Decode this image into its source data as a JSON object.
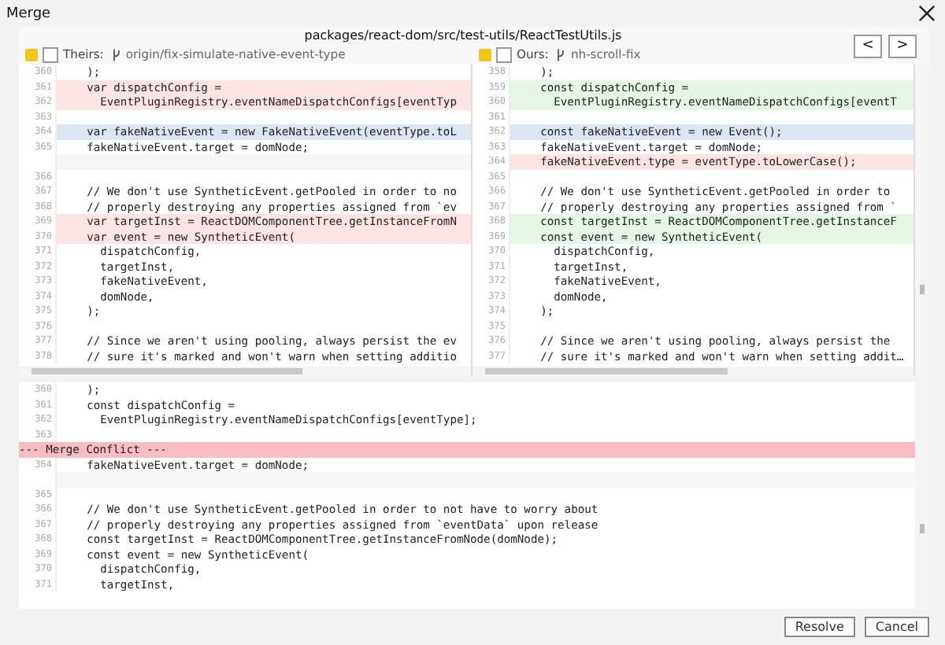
{
  "window": {
    "title": "Merge"
  },
  "file_path": "packages/react-dom/src/test-utils/ReactTestUtils.js",
  "navigation": [
    "<",
    ">"
  ],
  "theirs": {
    "label": "Theirs:",
    "branch": "origin/fix-simulate-native-event-type",
    "checked": false,
    "lines": [
      {
        "number": "360",
        "code": "    );",
        "kind": "plain"
      },
      {
        "number": "361",
        "code": "    var dispatchConfig =",
        "kind": "removed"
      },
      {
        "number": "362",
        "code": "      EventPluginRegistry.eventNameDispatchConfigs[eventTyp",
        "kind": "removed"
      },
      {
        "number": "363",
        "kind": "plain"
      },
      {
        "number": "364",
        "code": "    var fakeNativeEvent = new FakeNativeEvent(eventType.toL",
        "kind": "changed"
      },
      {
        "number": "365",
        "code": "    fakeNativeEvent.target = domNode;",
        "kind": "plain"
      },
      {
        "kind": "spacer"
      },
      {
        "number": "366",
        "kind": "plain"
      },
      {
        "number": "367",
        "code": "    // We don't use SyntheticEvent.getPooled in order to no",
        "kind": "plain"
      },
      {
        "number": "368",
        "code": "    // properly destroying any properties assigned from `ev",
        "kind": "plain"
      },
      {
        "number": "369",
        "code": "    var targetInst = ReactDOMComponentTree.getInstanceFromN",
        "kind": "removed"
      },
      {
        "number": "370",
        "code": "    var event = new SyntheticEvent(",
        "kind": "removed"
      },
      {
        "number": "371",
        "code": "      dispatchConfig,",
        "kind": "plain"
      },
      {
        "number": "372",
        "code": "      targetInst,",
        "kind": "plain"
      },
      {
        "number": "373",
        "code": "      fakeNativeEvent,",
        "kind": "plain"
      },
      {
        "number": "374",
        "code": "      domNode,",
        "kind": "plain"
      },
      {
        "number": "375",
        "code": "    );",
        "kind": "plain"
      },
      {
        "number": "376",
        "kind": "plain"
      },
      {
        "number": "377",
        "code": "    // Since we aren't using pooling, always persist the ev",
        "kind": "plain"
      },
      {
        "number": "378",
        "code": "    // sure it's marked and won't warn when setting additio",
        "kind": "plain"
      }
    ]
  },
  "ours": {
    "label": "Ours:",
    "branch": "nh-scroll-fix",
    "checked": false,
    "lines": [
      {
        "number": "358",
        "code": "    );",
        "kind": "plain"
      },
      {
        "number": "359",
        "code": "    const dispatchConfig =",
        "kind": "added"
      },
      {
        "number": "360",
        "code": "      EventPluginRegistry.eventNameDispatchConfigs[eventT",
        "kind": "added"
      },
      {
        "number": "361",
        "kind": "plain"
      },
      {
        "number": "362",
        "code": "    const fakeNativeEvent = new Event();",
        "kind": "changed"
      },
      {
        "number": "363",
        "code": "    fakeNativeEvent.target = domNode;",
        "kind": "plain"
      },
      {
        "number": "364",
        "code": "    fakeNativeEvent.type = eventType.toLowerCase();",
        "kind": "removed"
      },
      {
        "number": "365",
        "kind": "plain"
      },
      {
        "number": "366",
        "code": "    // We don't use SyntheticEvent.getPooled in order to",
        "kind": "plain"
      },
      {
        "number": "367",
        "code": "    // properly destroying any properties assigned from `",
        "kind": "plain"
      },
      {
        "number": "368",
        "code": "    const targetInst = ReactDOMComponentTree.getInstanceF",
        "kind": "added"
      },
      {
        "number": "369",
        "code": "    const event = new SyntheticEvent(",
        "kind": "added"
      },
      {
        "number": "370",
        "code": "      dispatchConfig,",
        "kind": "plain"
      },
      {
        "number": "371",
        "code": "      targetInst,",
        "kind": "plain"
      },
      {
        "number": "372",
        "code": "      fakeNativeEvent,",
        "kind": "plain"
      },
      {
        "number": "373",
        "code": "      domNode,",
        "kind": "plain"
      },
      {
        "number": "374",
        "code": "    );",
        "kind": "plain"
      },
      {
        "number": "375",
        "kind": "plain"
      },
      {
        "number": "376",
        "code": "    // Since we aren't using pooling, always persist the",
        "kind": "plain"
      },
      {
        "number": "377",
        "code": "    // sure it's marked and won't warn when setting addit…",
        "kind": "plain"
      }
    ]
  },
  "result": {
    "lines": [
      {
        "number": "360",
        "code": "    );",
        "kind": "plain"
      },
      {
        "number": "361",
        "code": "    const dispatchConfig =",
        "kind": "plain"
      },
      {
        "number": "362",
        "code": "      EventPluginRegistry.eventNameDispatchConfigs[eventType];",
        "kind": "plain"
      },
      {
        "number": "363",
        "kind": "plain"
      },
      {
        "code": "--- Merge Conflict ---",
        "kind": "conflict"
      },
      {
        "number": "364",
        "code": "    fakeNativeEvent.target = domNode;",
        "kind": "plain"
      },
      {
        "kind": "spacer"
      },
      {
        "number": "365",
        "kind": "plain"
      },
      {
        "number": "366",
        "code": "    // We don't use SyntheticEvent.getPooled in order to not have to worry about",
        "kind": "plain"
      },
      {
        "number": "367",
        "code": "    // properly destroying any properties assigned from `eventData` upon release",
        "kind": "plain"
      },
      {
        "number": "368",
        "code": "    const targetInst = ReactDOMComponentTree.getInstanceFromNode(domNode);",
        "kind": "plain"
      },
      {
        "number": "369",
        "code": "    const event = new SyntheticEvent(",
        "kind": "plain"
      },
      {
        "number": "370",
        "code": "      dispatchConfig,",
        "kind": "plain"
      },
      {
        "number": "371",
        "code": "      targetInst,",
        "kind": "plain"
      }
    ]
  },
  "buttons": [
    "Resolve",
    "Cancel"
  ]
}
